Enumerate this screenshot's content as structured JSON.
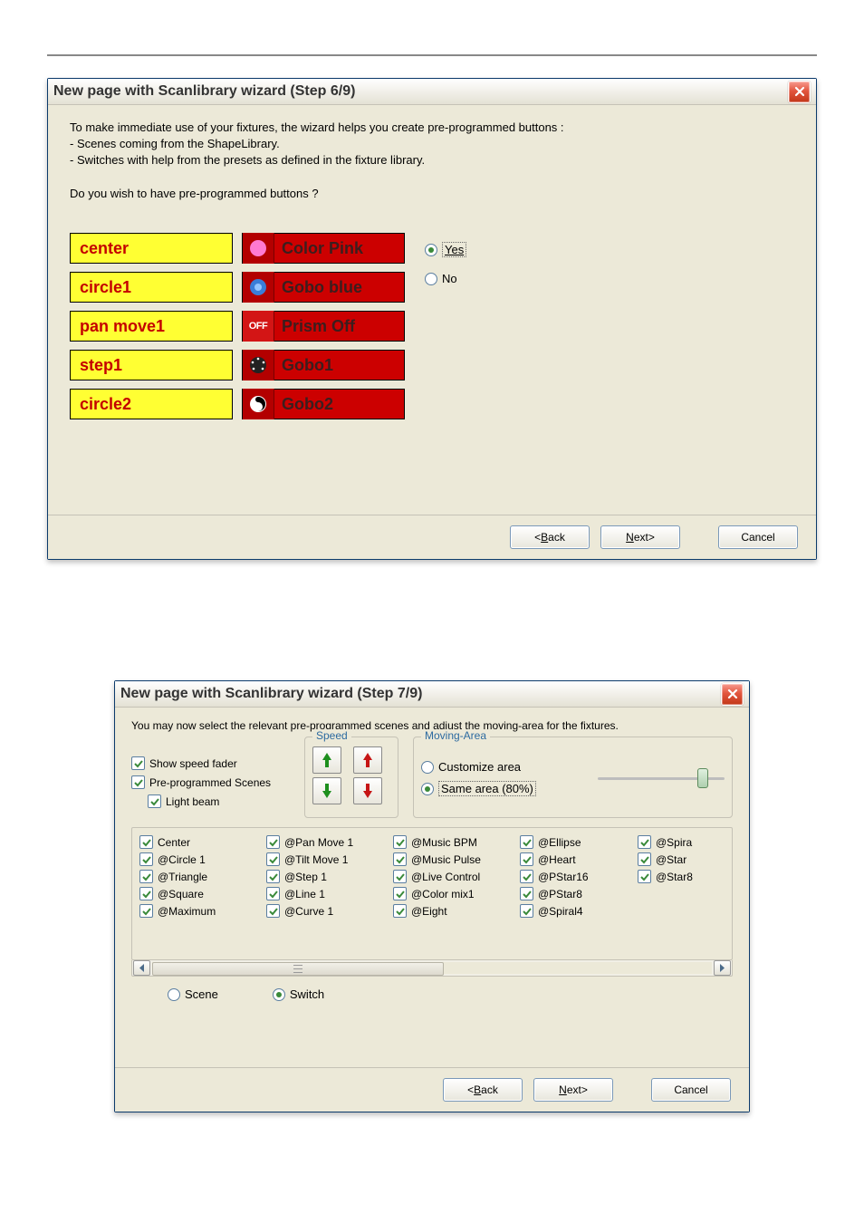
{
  "dialog6": {
    "title": "New page with Scanlibrary wizard (Step 6/9)",
    "intro_line1": "To make immediate use of your fixtures, the wizard helps you create pre-programmed buttons :",
    "intro_line2": "- Scenes coming from the ShapeLibrary.",
    "intro_line3": "- Switches with help from the presets as defined in the fixture library.",
    "question": "Do you wish to have pre-programmed buttons ?",
    "yellow": [
      "center",
      "circle1",
      "pan move1",
      "step1",
      "circle2"
    ],
    "red": [
      "Color Pink",
      "Gobo blue",
      "Prism Off",
      "Gobo1",
      "Gobo2"
    ],
    "red_icon": [
      "pink",
      "blue",
      "off",
      "gobo1",
      "gobo2"
    ],
    "yes": "Yes",
    "no": "No",
    "back": "Back",
    "back_prefix": "< ",
    "next": "Next",
    "next_suffix": " >",
    "cancel": "Cancel"
  },
  "dialog7": {
    "title": "New page with Scanlibrary wizard (Step 7/9)",
    "desc": "You may now select the relevant pre-programmed scenes and adjust the moving-area for the fixtures.",
    "show_speed": "Show speed fader",
    "preprog": "Pre-programmed Scenes",
    "lightbeam": "Light beam",
    "speed_label": "Speed",
    "moving_label": "Moving-Area",
    "custom_area": "Customize area",
    "same_area": "Same area (80%)",
    "scenes": {
      "col1": [
        "Center",
        "@Circle 1",
        "@Triangle",
        "@Square",
        "@Maximum"
      ],
      "col2": [
        "@Pan Move 1",
        "@Tilt Move 1",
        "@Step 1",
        "@Line 1",
        "@Curve 1"
      ],
      "col3": [
        "@Music BPM",
        "@Music Pulse",
        "@Live Control",
        "@Color mix1",
        "@Eight"
      ],
      "col4": [
        "@Ellipse",
        "@Heart",
        "@PStar16",
        "@PStar8",
        "@Spiral4"
      ],
      "col5": [
        "@Spira",
        "@Star",
        "@Star8"
      ]
    },
    "scene": "Scene",
    "switch": "Switch",
    "back": "Back",
    "back_prefix": "< ",
    "next": "Next",
    "next_suffix": " >",
    "cancel": "Cancel"
  },
  "icons": {
    "close": "close-icon"
  }
}
